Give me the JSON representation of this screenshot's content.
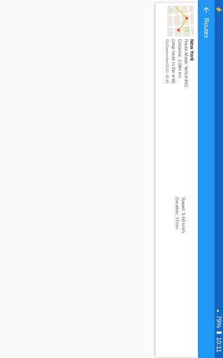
{
  "statusbar": {
    "time": "10:11",
    "battery": "79%",
    "icons": [
      "wifi-icon",
      "battery-icon",
      "signal-icon"
    ]
  },
  "appbar": {
    "title": "Routes"
  },
  "routes": [
    {
      "city": "New York",
      "mode": "Route Mode: WALKING",
      "distance": "Distance: 3.084 km",
      "stop": "(stop route in the end)",
      "date": "05/September/2016 08:40",
      "speed": "Speed: 5.00 km/h",
      "duration": "Duration: 37min"
    }
  ],
  "colors": {
    "appbar": "#2196f3",
    "statusbar": "#1565c0",
    "background": "#fafafa"
  }
}
